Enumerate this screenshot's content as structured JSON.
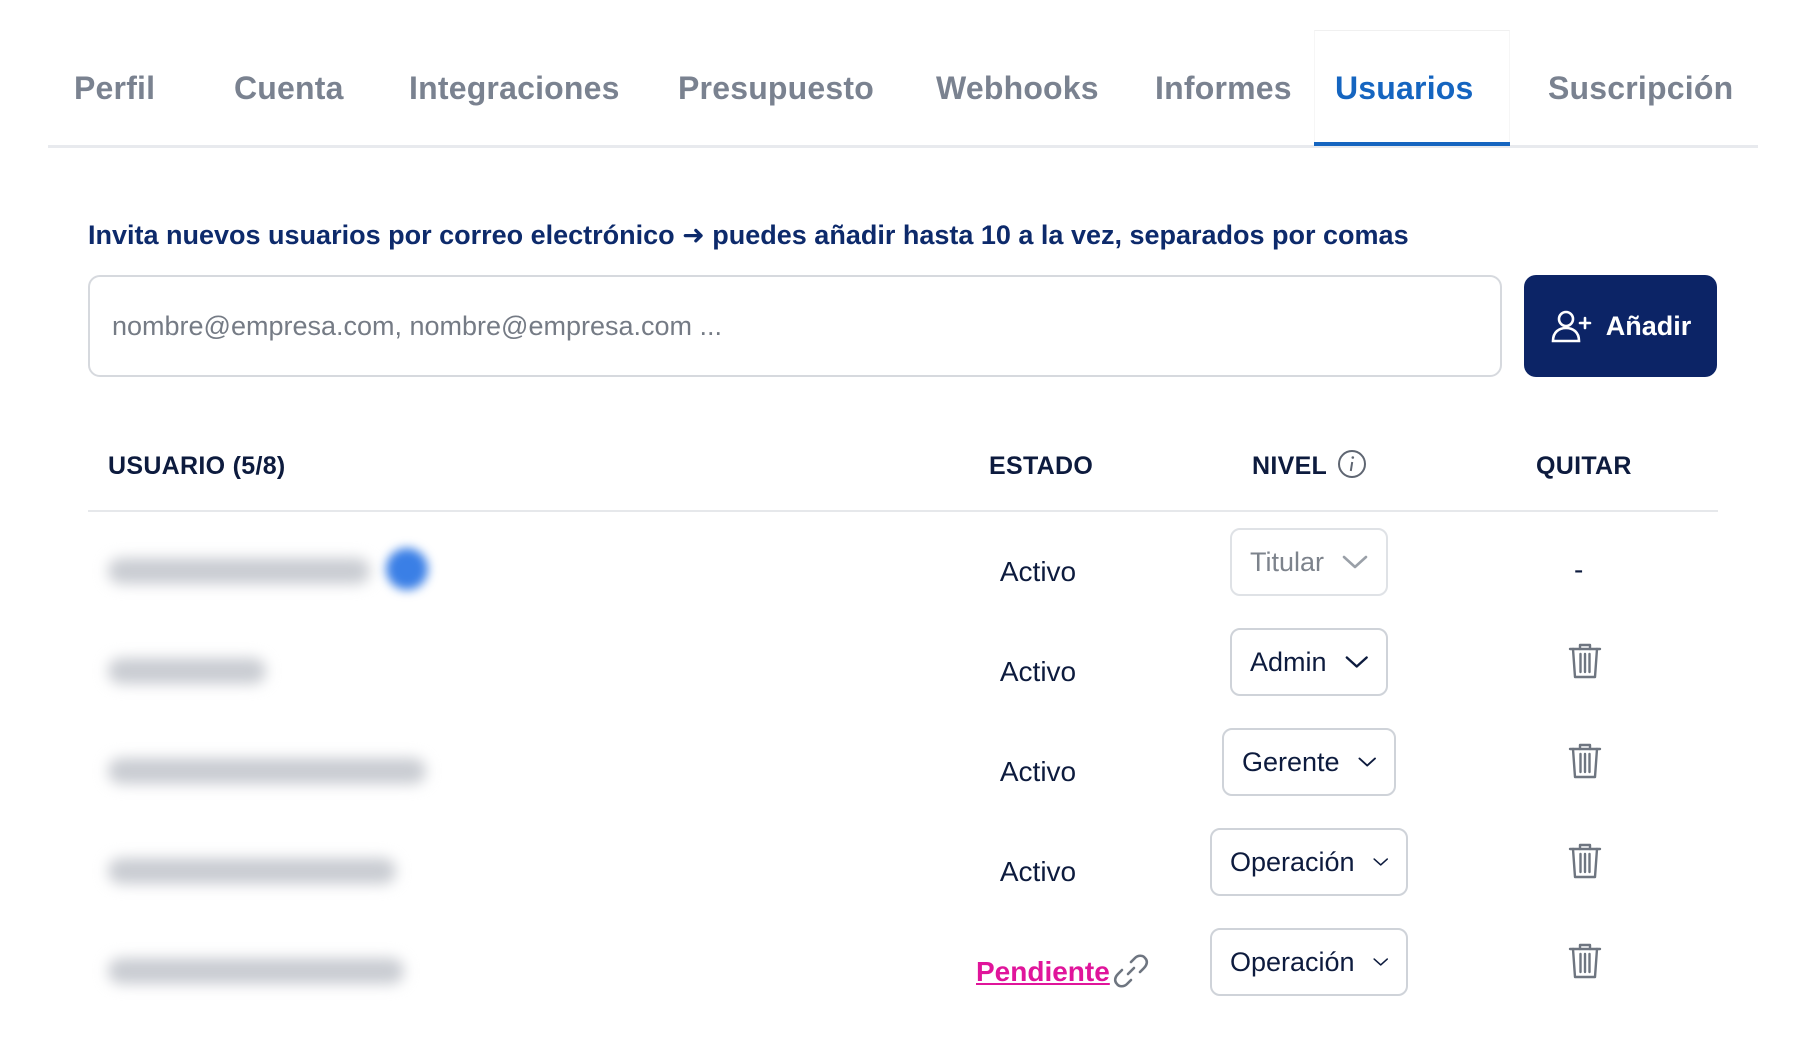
{
  "tabs": [
    {
      "label": "Perfil",
      "active": false
    },
    {
      "label": "Cuenta",
      "active": false
    },
    {
      "label": "Integraciones",
      "active": false
    },
    {
      "label": "Presupuesto",
      "active": false
    },
    {
      "label": "Webhooks",
      "active": false
    },
    {
      "label": "Informes",
      "active": false
    },
    {
      "label": "Usuarios",
      "active": true
    },
    {
      "label": "Suscripción",
      "active": false
    }
  ],
  "invite": {
    "label": "Invita nuevos usuarios por correo electrónico ➜ puedes añadir hasta 10 a la vez, separados por comas",
    "placeholder": "nombre@empresa.com, nombre@empresa.com ...",
    "add_label": "Añadir",
    "add_icon": "user-plus-icon"
  },
  "table": {
    "headers": {
      "user": "USUARIO (5/8)",
      "status": "ESTADO",
      "level": "NIVEL",
      "remove": "QUITAR"
    },
    "rows": [
      {
        "status": "Activo",
        "level": "Titular",
        "level_editable": false,
        "remove": "-"
      },
      {
        "status": "Activo",
        "level": "Admin",
        "level_editable": true,
        "remove": "trash-icon"
      },
      {
        "status": "Activo",
        "level": "Gerente",
        "level_editable": true,
        "remove": "trash-icon"
      },
      {
        "status": "Activo",
        "level": "Operación",
        "level_editable": true,
        "remove": "trash-icon"
      },
      {
        "status": "Pendiente",
        "level": "Operación",
        "level_editable": true,
        "remove": "trash-icon",
        "status_icon": "link-icon"
      }
    ]
  },
  "colors": {
    "active_tab": "#1565c0",
    "primary_button": "#0c2466",
    "pending": "#e0159b",
    "heading": "#0d2a6b"
  }
}
